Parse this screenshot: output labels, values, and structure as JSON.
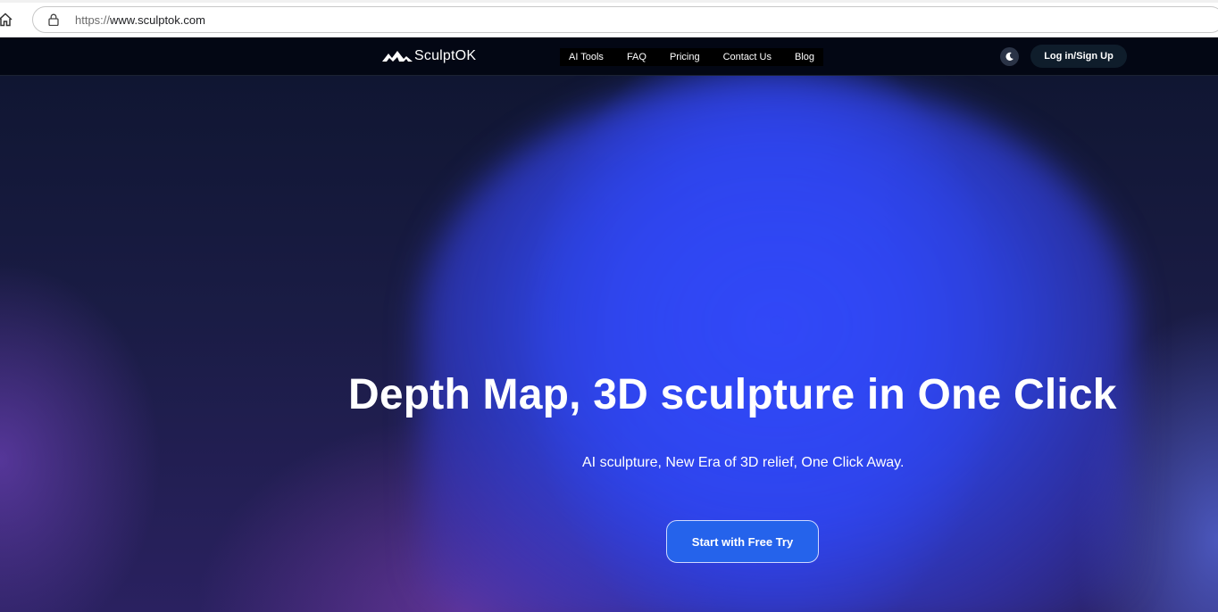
{
  "browser": {
    "url_scheme": "https://",
    "url_host": "www.sculptok.com",
    "home_icon": "home-icon",
    "lock_icon": "lock-icon"
  },
  "header": {
    "logo_text": "SculptOK",
    "nav": [
      {
        "label": "AI Tools"
      },
      {
        "label": "FAQ"
      },
      {
        "label": "Pricing"
      },
      {
        "label": "Contact Us"
      },
      {
        "label": "Blog"
      }
    ],
    "theme_icon": "moon-icon",
    "login_label": "Log in/Sign Up"
  },
  "hero": {
    "title": "Depth Map, 3D sculpture in One Click",
    "subtitle": "AI sculpture, New Era of 3D relief, One Click Away.",
    "cta_label": "Start with Free Try"
  },
  "colors": {
    "header_bg": "#030714",
    "hero_blue": "#2f4df7",
    "cta_bg": "#2563eb",
    "login_bg": "#0f1d2b"
  }
}
